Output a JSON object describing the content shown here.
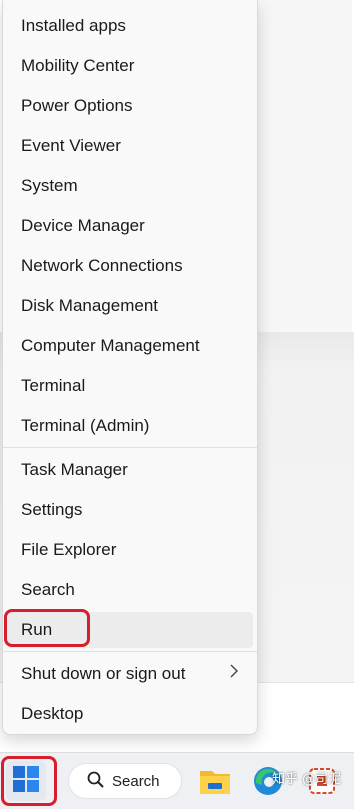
{
  "menu": {
    "items": [
      {
        "label": "Installed apps"
      },
      {
        "label": "Mobility Center"
      },
      {
        "label": "Power Options"
      },
      {
        "label": "Event Viewer"
      },
      {
        "label": "System"
      },
      {
        "label": "Device Manager"
      },
      {
        "label": "Network Connections"
      },
      {
        "label": "Disk Management"
      },
      {
        "label": "Computer Management"
      },
      {
        "label": "Terminal"
      },
      {
        "label": "Terminal (Admin)"
      },
      {
        "label": "Task Manager"
      },
      {
        "label": "Settings"
      },
      {
        "label": "File Explorer"
      },
      {
        "label": "Search"
      },
      {
        "label": "Run"
      },
      {
        "label": "Shut down or sign out",
        "submenu_icon": "chevron-right-icon"
      },
      {
        "label": "Desktop"
      }
    ],
    "hovered_item": "Run",
    "highlight_color": "#d61f2e"
  },
  "taskbar": {
    "start_icon": "windows-logo-icon",
    "search_label": "Search",
    "search_icon": "search-icon",
    "pinned": [
      "file-explorer-icon",
      "edge-icon",
      "app-icon"
    ],
    "watermark": "知乎 @司泥"
  }
}
